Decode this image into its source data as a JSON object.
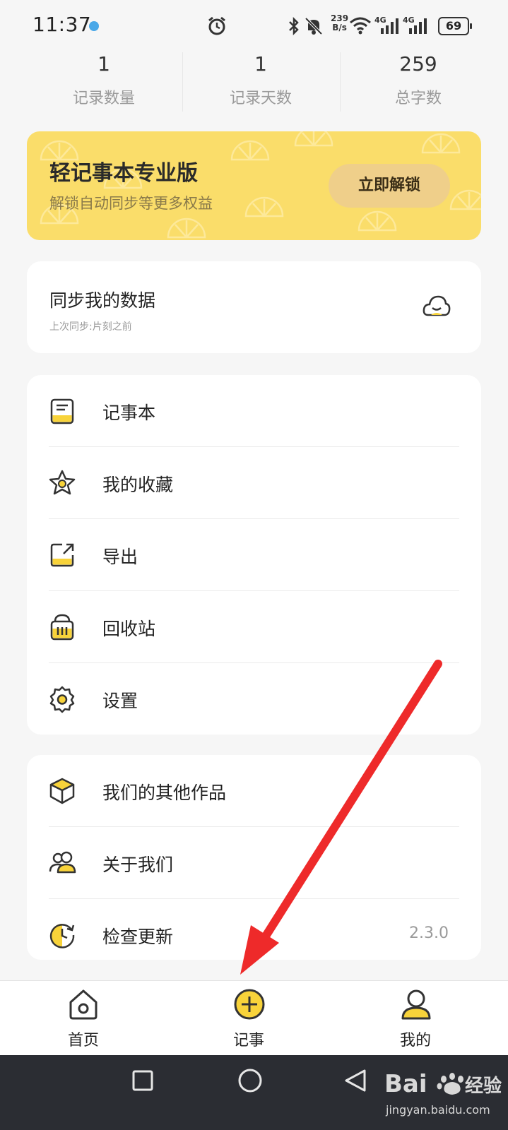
{
  "status_bar": {
    "time": "11:37",
    "net_speed_value": "239",
    "net_speed_unit": "B/s",
    "network_1": "4G",
    "network_2": "4G",
    "battery": "69"
  },
  "stats": [
    {
      "value": "1",
      "label": "记录数量"
    },
    {
      "value": "1",
      "label": "记录天数"
    },
    {
      "value": "259",
      "label": "总字数"
    }
  ],
  "pro_banner": {
    "title": "轻记事本专业版",
    "subtitle": "解锁自动同步等更多权益",
    "button": "立即解锁",
    "color": "#fadd6a"
  },
  "sync": {
    "title": "同步我的数据",
    "subtitle": "上次同步:片刻之前",
    "icon": "cloud-icon"
  },
  "menu_main": [
    {
      "label": "记事本",
      "icon": "notebook-icon"
    },
    {
      "label": "我的收藏",
      "icon": "favorite-star-icon"
    },
    {
      "label": "导出",
      "icon": "export-icon"
    },
    {
      "label": "回收站",
      "icon": "trash-icon"
    },
    {
      "label": "设置",
      "icon": "gear-icon"
    }
  ],
  "menu_other": [
    {
      "label": "我们的其他作品",
      "icon": "cube-icon"
    },
    {
      "label": "关于我们",
      "icon": "users-icon"
    },
    {
      "label": "检查更新",
      "icon": "update-clock-icon",
      "value": "2.3.0"
    }
  ],
  "bottom_nav": [
    {
      "label": "首页",
      "icon": "home-icon"
    },
    {
      "label": "记事",
      "icon": "add-circle-icon"
    },
    {
      "label": "我的",
      "icon": "profile-icon"
    }
  ],
  "accent_color": "#f8d33a",
  "watermark": {
    "brand": "Bai",
    "brand_suffix": "经验",
    "url": "jingyan.baidu.com"
  }
}
